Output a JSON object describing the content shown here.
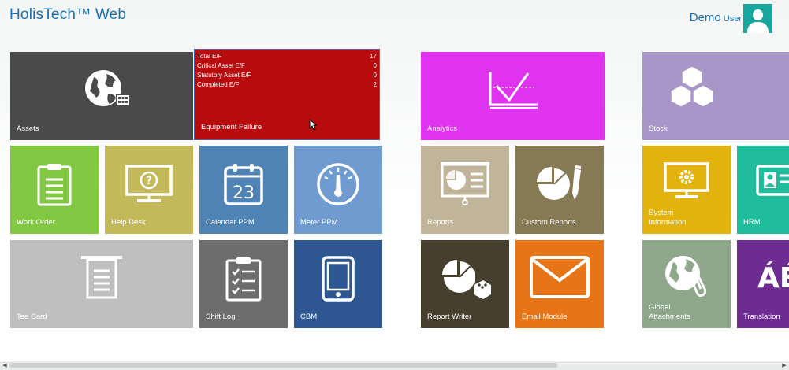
{
  "header": {
    "title": "HolisTech™ Web",
    "user_name": "Demo",
    "user_role": "User"
  },
  "tiles": {
    "assets": "Assets",
    "equipment_failure": "Equipment Failure",
    "analytics": "Analytics",
    "stock": "Stock",
    "work_order": "Work Order",
    "help_desk": "Help Desk",
    "calendar_ppm": "Calendar PPM",
    "meter_ppm": "Meter PPM",
    "reports": "Reports",
    "custom_reports": "Custom Reports",
    "system_information_1": "System",
    "system_information_2": "Information",
    "hrm": "HRM",
    "tee_card": "Tee Card",
    "shift_log": "Shift Log",
    "cbm": "CBM",
    "report_writer": "Report Writer",
    "email_module": "Email Module",
    "global_attachments_1": "Global",
    "global_attachments_2": "Attachments",
    "translation": "Translation"
  },
  "equipment_failure_stats": [
    {
      "label": "Total E/F",
      "value": "17"
    },
    {
      "label": "Critical Asset E/F",
      "value": "0"
    },
    {
      "label": "Statutory Asset E/F",
      "value": "0"
    },
    {
      "label": "Completed E/F",
      "value": "2"
    }
  ],
  "calendar_day": "23",
  "translation_glyph": "ÁÉ",
  "colors": {
    "title_blue": "#1a6fb4",
    "assets": "#4a4a4a",
    "equipment_failure": "#b70b0e",
    "analytics": "#e033f0",
    "stock": "#a896c8",
    "work_order": "#83c843",
    "help_desk": "#c3b95a",
    "calendar_ppm": "#4f83b5",
    "meter_ppm": "#6f9bd0",
    "reports": "#c0b49a",
    "custom_reports": "#857a54",
    "system_information": "#e2b20f",
    "hrm": "#1fbd9b",
    "tee_card": "#bfbfbf",
    "shift_log": "#6d6d6d",
    "cbm": "#2e5691",
    "report_writer": "#473f2e",
    "email_module": "#e77518",
    "global_attachments": "#8fa88c",
    "translation": "#6c2c92"
  },
  "icons": {
    "assets": "globe-grid-icon",
    "analytics": "line-chart-icon",
    "stock": "cubes-icon",
    "work_order": "clipboard-icon",
    "help_desk": "monitor-question-icon",
    "calendar_ppm": "calendar-icon",
    "meter_ppm": "gauge-icon",
    "reports": "presentation-pie-icon",
    "custom_reports": "pie-pen-icon",
    "system_information": "monitor-gear-icon",
    "hrm": "id-card-icon",
    "tee_card": "document-icon",
    "shift_log": "checklist-icon",
    "cbm": "tablet-icon",
    "report_writer": "pie-lego-icon",
    "email_module": "envelope-icon",
    "global_attachments": "globe-paperclip-icon"
  }
}
